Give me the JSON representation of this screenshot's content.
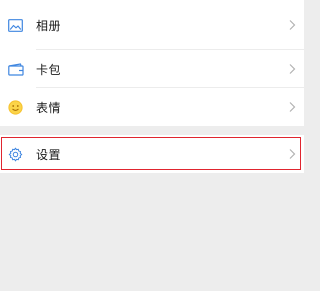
{
  "menu": {
    "album_label": "相册",
    "cards_label": "卡包",
    "stickers_label": "表情",
    "settings_label": "设置"
  },
  "icons": {
    "album": "image-icon",
    "cards": "wallet-icon",
    "stickers": "smiley-icon",
    "settings": "gear-icon",
    "chevron": "chevron-right-icon"
  },
  "colors": {
    "album_icon": "#3f86e0",
    "cards_icon": "#3f86e0",
    "stickers_icon": "#f6c12c",
    "settings_icon": "#3f86e0",
    "highlight_border": "#e0252f"
  }
}
